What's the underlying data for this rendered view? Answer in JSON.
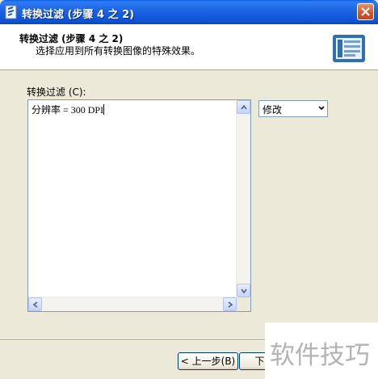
{
  "window": {
    "title": "转换过滤 (步骤 4 之 2)"
  },
  "header": {
    "title": "转换过滤 (步骤 4 之 2)",
    "subtitle": "选择应用到所有转换图像的特殊效果。"
  },
  "filter": {
    "label": "转换过滤 (C):",
    "text": "分辨率 = 300 DPI"
  },
  "action_select": {
    "value": "修改"
  },
  "buttons": {
    "back": "< 上一步(B)",
    "next": "下一步"
  },
  "watermark": {
    "text": "软件技巧"
  },
  "colors": {
    "titlebar": "#0c52d4",
    "dialog_bg": "#ece9d8",
    "close_button": "#d4532d"
  },
  "icons": {
    "app": "app-icon",
    "close": "close-icon",
    "wizard": "wizard-icon",
    "dropdown": "chevron-down-icon"
  }
}
